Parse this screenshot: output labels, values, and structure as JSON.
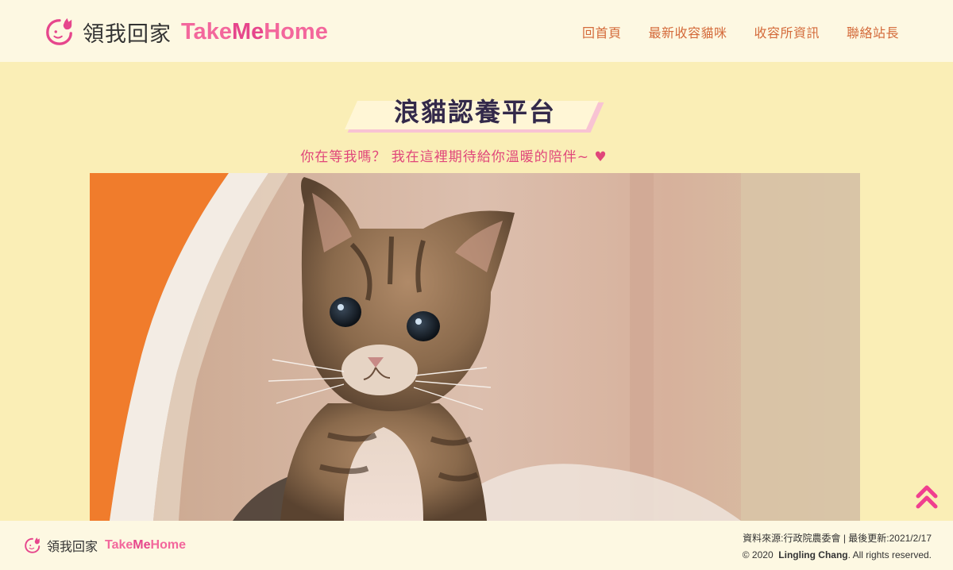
{
  "header": {
    "brand_cn": "領我回家",
    "brand_en_a": "Take",
    "brand_en_b": "Me",
    "brand_en_c": "Home",
    "logo_icon": "cat-logo-icon",
    "nav": [
      {
        "label": "回首頁"
      },
      {
        "label": "最新收容貓咪"
      },
      {
        "label": "收容所資訊"
      },
      {
        "label": "聯絡站長"
      }
    ]
  },
  "hero": {
    "title": "浪貓認養平台",
    "subtitle": "你在等我嗎？ 我在這裡期待給你溫暖的陪伴~ ♥",
    "image_subject": "kitten-photo"
  },
  "back_to_top_icon": "double-chevron-up-icon",
  "footer": {
    "brand_cn": "領我回家",
    "brand_en_a": "Take",
    "brand_en_b": "Me",
    "brand_en_c": "Home",
    "source_line": "資料來源:行政院農委會 | 最後更新:2021/2/17",
    "copyright_prefix": "© 2020",
    "author": "Lingling Chang",
    "copyright_suffix": ". All rights reserved."
  },
  "colors": {
    "page_bg": "#faeeb6",
    "bar_bg": "#fdf8e2",
    "nav_text": "#d46b3b",
    "accent_pink": "#f3679c",
    "accent_magenta": "#e6468c",
    "title_text": "#33294a"
  }
}
